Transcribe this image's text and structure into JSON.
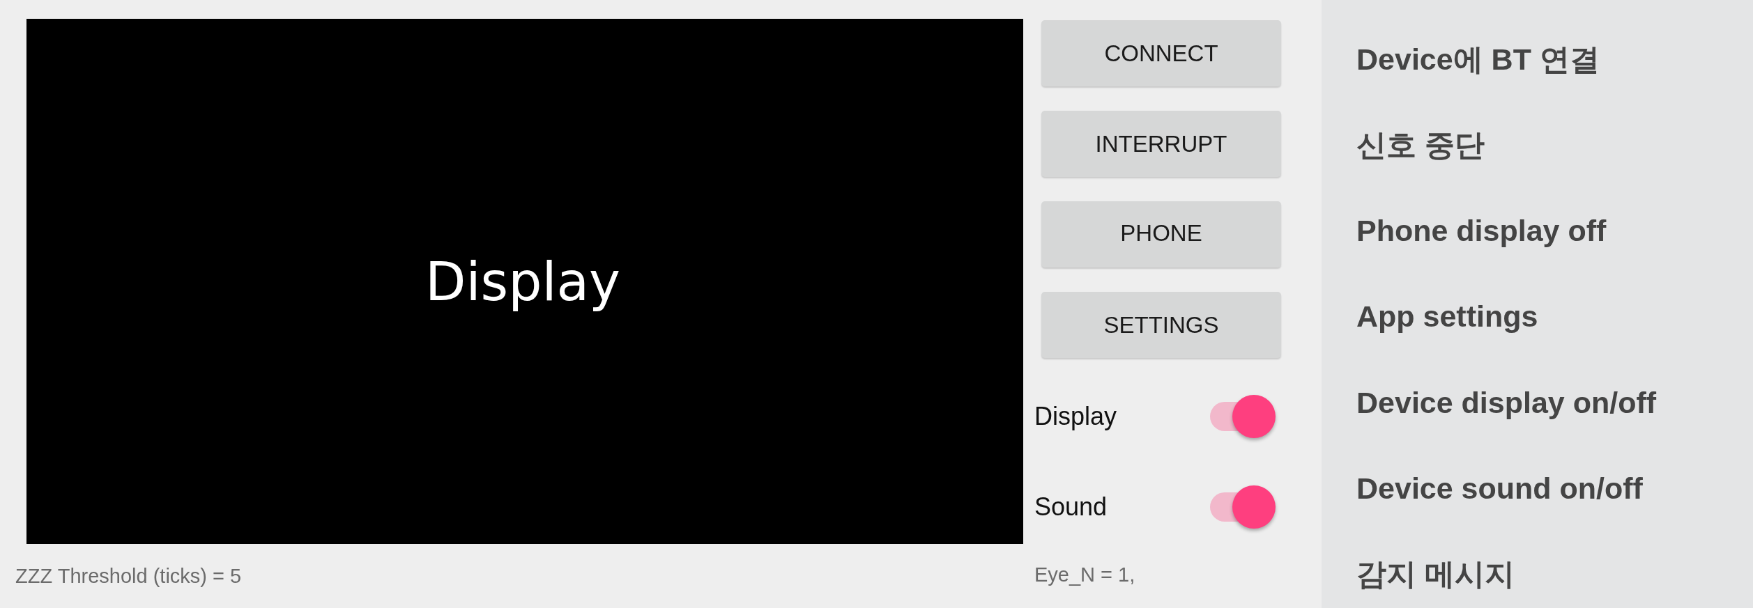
{
  "display": {
    "label": "Display"
  },
  "threshold": "ZZZ Threshold (ticks) = 5",
  "buttons": [
    {
      "label": "CONNECT"
    },
    {
      "label": "INTERRUPT"
    },
    {
      "label": "PHONE"
    },
    {
      "label": "SETTINGS"
    }
  ],
  "toggles": [
    {
      "label": "Display",
      "on": true
    },
    {
      "label": "Sound",
      "on": true
    }
  ],
  "eye_reading": "Eye_N = 1,",
  "legend": [
    "Device에 BT 연결",
    "신호 중단",
    "Phone display off",
    "App settings",
    "Device display on/off",
    "Device sound on/off",
    "감지 메시지"
  ]
}
